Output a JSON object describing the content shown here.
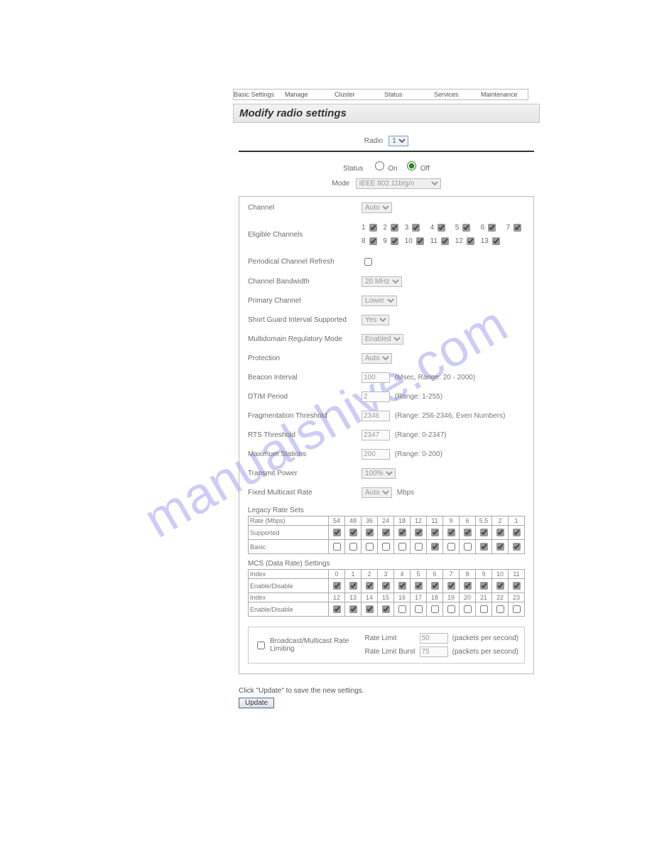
{
  "watermark": "manualshive.com",
  "tabs": [
    "Basic Settings",
    "Manage",
    "Cluster",
    "Status",
    "Services",
    "Maintenance"
  ],
  "title": "Modify radio settings",
  "radio": {
    "label": "Radio",
    "value": "1"
  },
  "status": {
    "label": "Status",
    "on": "On",
    "off": "Off",
    "value": "off"
  },
  "mode": {
    "label": "Mode",
    "value": "IEEE 802.11b/g/n"
  },
  "fields": {
    "channel": {
      "label": "Channel",
      "value": "Auto"
    },
    "eligible": {
      "label": "Eligible Channels",
      "items": [
        "1",
        "2",
        "3",
        "4",
        "5",
        "6",
        "7",
        "8",
        "9",
        "10",
        "11",
        "12",
        "13"
      ]
    },
    "periodical": {
      "label": "Periodical Channel Refresh",
      "checked": false
    },
    "bandwidth": {
      "label": "Channel Bandwidth",
      "value": "20 MHz"
    },
    "primary": {
      "label": "Primary Channel",
      "value": "Lower"
    },
    "sgi": {
      "label": "Short Guard Interval Supported",
      "value": "Yes"
    },
    "regmode": {
      "label": "Multidomain Regulatory Mode",
      "value": "Enabled"
    },
    "protection": {
      "label": "Protection",
      "value": "Auto"
    },
    "beacon": {
      "label": "Beacon Interval",
      "value": "100",
      "note": "(Msec, Range: 20 - 2000)"
    },
    "dtim": {
      "label": "DTIM Period",
      "value": "2",
      "note": "(Range: 1-255)"
    },
    "frag": {
      "label": "Fragmentation Threshold",
      "value": "2346",
      "note": "(Range: 256-2346, Even Numbers)"
    },
    "rts": {
      "label": "RTS Threshold",
      "value": "2347",
      "note": "(Range: 0-2347)"
    },
    "maxsta": {
      "label": "Maximum Stations",
      "value": "200",
      "note": "(Range: 0-200)"
    },
    "txpower": {
      "label": "Transmit Power",
      "value": "100%"
    },
    "fmc": {
      "label": "Fixed Multicast Rate",
      "value": "Auto",
      "suffix": "Mbps"
    }
  },
  "legacy": {
    "title": "Legacy Rate Sets",
    "rowHeader": "Rate (Mbps)",
    "rates": [
      "54",
      "48",
      "36",
      "24",
      "18",
      "12",
      "11",
      "9",
      "6",
      "5.5",
      "2",
      "1"
    ],
    "supportedLabel": "Supported",
    "supported": [
      true,
      true,
      true,
      true,
      true,
      true,
      true,
      true,
      true,
      true,
      true,
      true
    ],
    "basicLabel": "Basic",
    "basic": [
      false,
      false,
      false,
      false,
      false,
      false,
      true,
      false,
      false,
      true,
      true,
      true
    ]
  },
  "mcs": {
    "title": "MCS (Data Rate) Settings",
    "indexLabel": "Index",
    "enableLabel": "Enable/Disable",
    "row1": [
      "0",
      "1",
      "2",
      "3",
      "4",
      "5",
      "6",
      "7",
      "8",
      "9",
      "10",
      "11"
    ],
    "row1en": [
      true,
      true,
      true,
      true,
      true,
      true,
      true,
      true,
      true,
      true,
      true,
      true
    ],
    "row2": [
      "12",
      "13",
      "14",
      "15",
      "16",
      "17",
      "18",
      "19",
      "20",
      "21",
      "22",
      "23"
    ],
    "row2en": [
      true,
      true,
      true,
      true,
      false,
      false,
      false,
      false,
      false,
      false,
      false,
      false
    ]
  },
  "ratelimit": {
    "checkbox": "Broadcast/Multicast Rate Limiting",
    "rlLabel": "Rate Limit",
    "rlValue": "50",
    "rlbLabel": "Rate Limit Burst",
    "rlbValue": "75",
    "unit": "(packets per second)"
  },
  "footer": {
    "hint": "Click \"Update\" to save the new settings.",
    "button": "Update"
  }
}
